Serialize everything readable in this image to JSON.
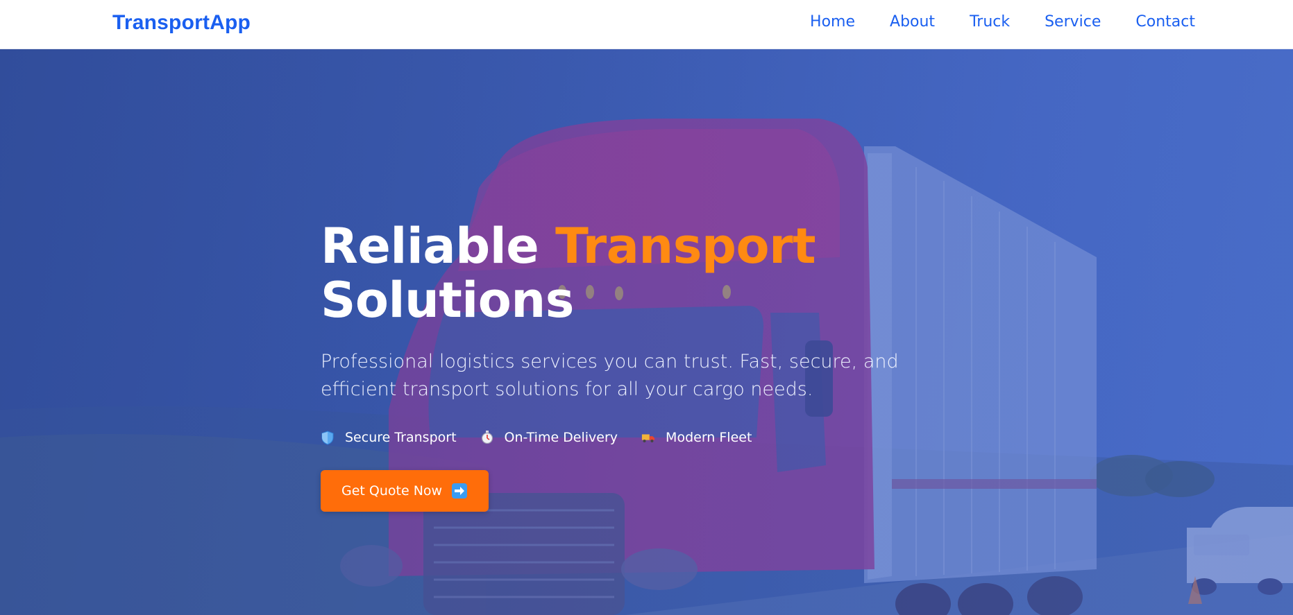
{
  "brand": {
    "name": "TransportApp",
    "color": "#1a5ff0"
  },
  "nav": {
    "items": [
      {
        "label": "Home"
      },
      {
        "label": "About"
      },
      {
        "label": "Truck"
      },
      {
        "label": "Service"
      },
      {
        "label": "Contact"
      }
    ]
  },
  "hero": {
    "title_part1": "Reliable ",
    "title_accent": "Transport",
    "title_part2": "Solutions",
    "subtitle": "Professional logistics services you can trust. Fast, secure, and efficient transport solutions for all your cargo needs.",
    "features": [
      {
        "icon": "shield-icon",
        "label": "Secure Transport"
      },
      {
        "icon": "clock-icon",
        "label": "On-Time Delivery"
      },
      {
        "icon": "truck-icon",
        "label": "Modern Fleet"
      }
    ],
    "cta": {
      "label": "Get Quote Now",
      "icon": "arrow-right-icon"
    }
  },
  "colors": {
    "accent": "#ff8a12",
    "cta_background": "#ff6d0a",
    "hero_overlay": "#3f5fb8",
    "nav_text": "#1a5ff0"
  }
}
